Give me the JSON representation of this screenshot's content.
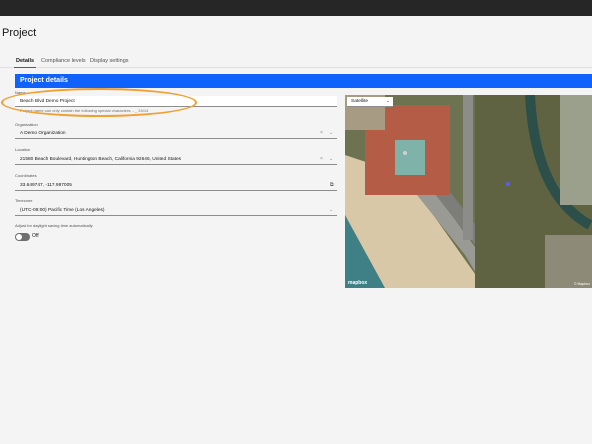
{
  "page": {
    "title": "Project"
  },
  "tabs": [
    {
      "label": "Details",
      "active": true
    },
    {
      "label": "Compliance levels",
      "active": false
    },
    {
      "label": "Display settings",
      "active": false
    }
  ],
  "panel": {
    "title": "Project details"
  },
  "form": {
    "name": {
      "label": "Name",
      "value": "Beach Blvd Demo Project",
      "helper": "Project name can only contain the following special characters: - _",
      "counter": "24/14"
    },
    "organization": {
      "label": "Organization",
      "value": "A Demo Organization"
    },
    "location": {
      "label": "Location",
      "value": "21580 Beach Boulevard, Huntington Beach, California 92646, United States"
    },
    "coordinates": {
      "label": "Coordinates",
      "value": "33.649747, -117.987005"
    },
    "timezone": {
      "label": "Timezone",
      "value": "(UTC-08:00) Pacific Time (Los Angeles)"
    },
    "dst": {
      "label": "Adjust for daylight saving time automatically",
      "state": "Off"
    }
  },
  "map": {
    "style_select": "Satellite",
    "logo": "mapbox",
    "attribution": "© Mapbox"
  },
  "colors": {
    "accent": "#0f62fe",
    "annotation": "#f0a030",
    "topbar": "#262626"
  },
  "icons": {
    "clear": "close-icon",
    "dropdown": "chevron-down-icon",
    "copy": "copy-icon",
    "marker": "map-marker-icon"
  }
}
